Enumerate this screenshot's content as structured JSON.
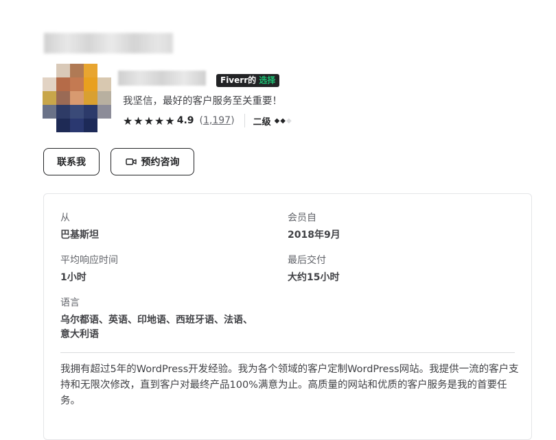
{
  "seller": {
    "badge_part1": "Fiverr的",
    "badge_part2": "选择",
    "tagline": "我坚信，最好的客户服务至关重要！",
    "rating": {
      "stars_glyphs": "★★★★★",
      "score": "4.9",
      "reviews_open": "(",
      "reviews_count": "1,197",
      "reviews_close": ")",
      "value": 4.9
    },
    "level": "二级",
    "level_diamonds_filled": "◆◆",
    "level_diamonds_empty": "◆",
    "level_value": 2,
    "level_max": 3
  },
  "actions": {
    "contact_label": "联系我",
    "book_label": "预约咨询",
    "book_icon": "video-icon"
  },
  "info": {
    "from_label": "从",
    "from_value": "巴基斯坦",
    "member_since_label": "会员自",
    "member_since_value": "2018年9月",
    "response_label": "平均响应时间",
    "response_value": "1小时",
    "last_delivery_label": "最后交付",
    "last_delivery_value": "大约15小时",
    "languages_label": "语言",
    "languages_line1": "乌尔都语、英语、印地语、西班牙语、法语、",
    "languages_line2": "意大利语"
  },
  "description": "我拥有超过5年的WordPress开发经验。我为各个领域的客户定制WordPress网站。我提供一流的客户支持和无限次修改，直到客户对最终产品100%满意为止。高质量的网站和优质的客户服务是我的首要任务。",
  "colors": {
    "accent_green": "#1dbf73",
    "badge_bg": "#222325",
    "text": "#404145",
    "muted": "#62646a"
  }
}
